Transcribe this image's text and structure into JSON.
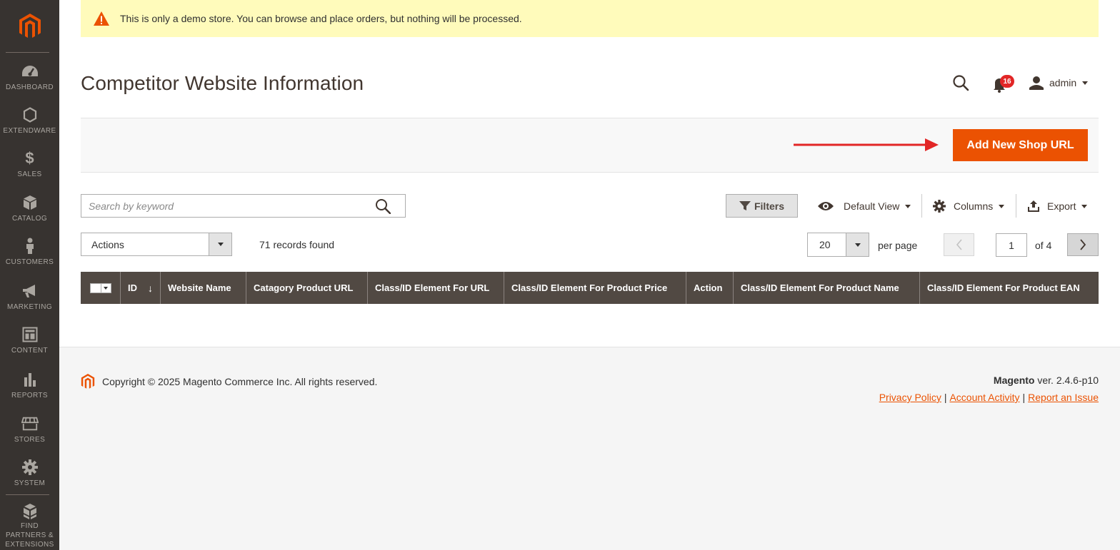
{
  "sidebar": {
    "items": [
      {
        "label": "DASHBOARD",
        "icon": "dashboard-icon"
      },
      {
        "label": "EXTENDWARE",
        "icon": "hexagon-icon"
      },
      {
        "label": "SALES",
        "icon": "dollar-icon"
      },
      {
        "label": "CATALOG",
        "icon": "box-icon"
      },
      {
        "label": "CUSTOMERS",
        "icon": "person-icon"
      },
      {
        "label": "MARKETING",
        "icon": "megaphone-icon"
      },
      {
        "label": "CONTENT",
        "icon": "layout-icon"
      },
      {
        "label": "REPORTS",
        "icon": "bar-chart-icon"
      },
      {
        "label": "STORES",
        "icon": "store-icon"
      },
      {
        "label": "SYSTEM",
        "icon": "gear-icon"
      },
      {
        "label": "FIND PARTNERS & EXTENSIONS",
        "icon": "blocks-icon"
      }
    ]
  },
  "notice": {
    "text": "This is only a demo store. You can browse and place orders, but nothing will be processed."
  },
  "page": {
    "title": "Competitor Website Information"
  },
  "header": {
    "notification_count": "16",
    "user": "admin"
  },
  "toolbar": {
    "add_button": "Add New Shop URL"
  },
  "search": {
    "placeholder": "Search by keyword",
    "value": ""
  },
  "controls": {
    "filters": "Filters",
    "view": "Default View",
    "columns": "Columns",
    "export": "Export"
  },
  "actions": {
    "label": "Actions"
  },
  "records": {
    "text": "71 records found"
  },
  "pagination": {
    "per_page_value": "20",
    "per_page_label": "per page",
    "current_page": "1",
    "of_pages": "of 4"
  },
  "grid": {
    "columns": [
      "ID",
      "Website Name",
      "Catagory Product URL",
      "Class/ID Element For URL",
      "Class/ID Element For Product Price",
      "Action",
      "Class/ID Element For Product Name",
      "Class/ID Element For Product EAN"
    ],
    "sort_indicator": "↓"
  },
  "footer": {
    "copyright": "Copyright © 2025 Magento Commerce Inc. All rights reserved.",
    "brand": "Magento",
    "version": "ver. 2.4.6-p10",
    "links": [
      "Privacy Policy",
      "Account Activity",
      "Report an Issue"
    ],
    "separator": "|"
  },
  "colors": {
    "accent": "#eb5202",
    "sidebar": "#373330",
    "grid_header": "#514943",
    "notice_bg": "#fffbbb",
    "badge": "#e22626"
  }
}
